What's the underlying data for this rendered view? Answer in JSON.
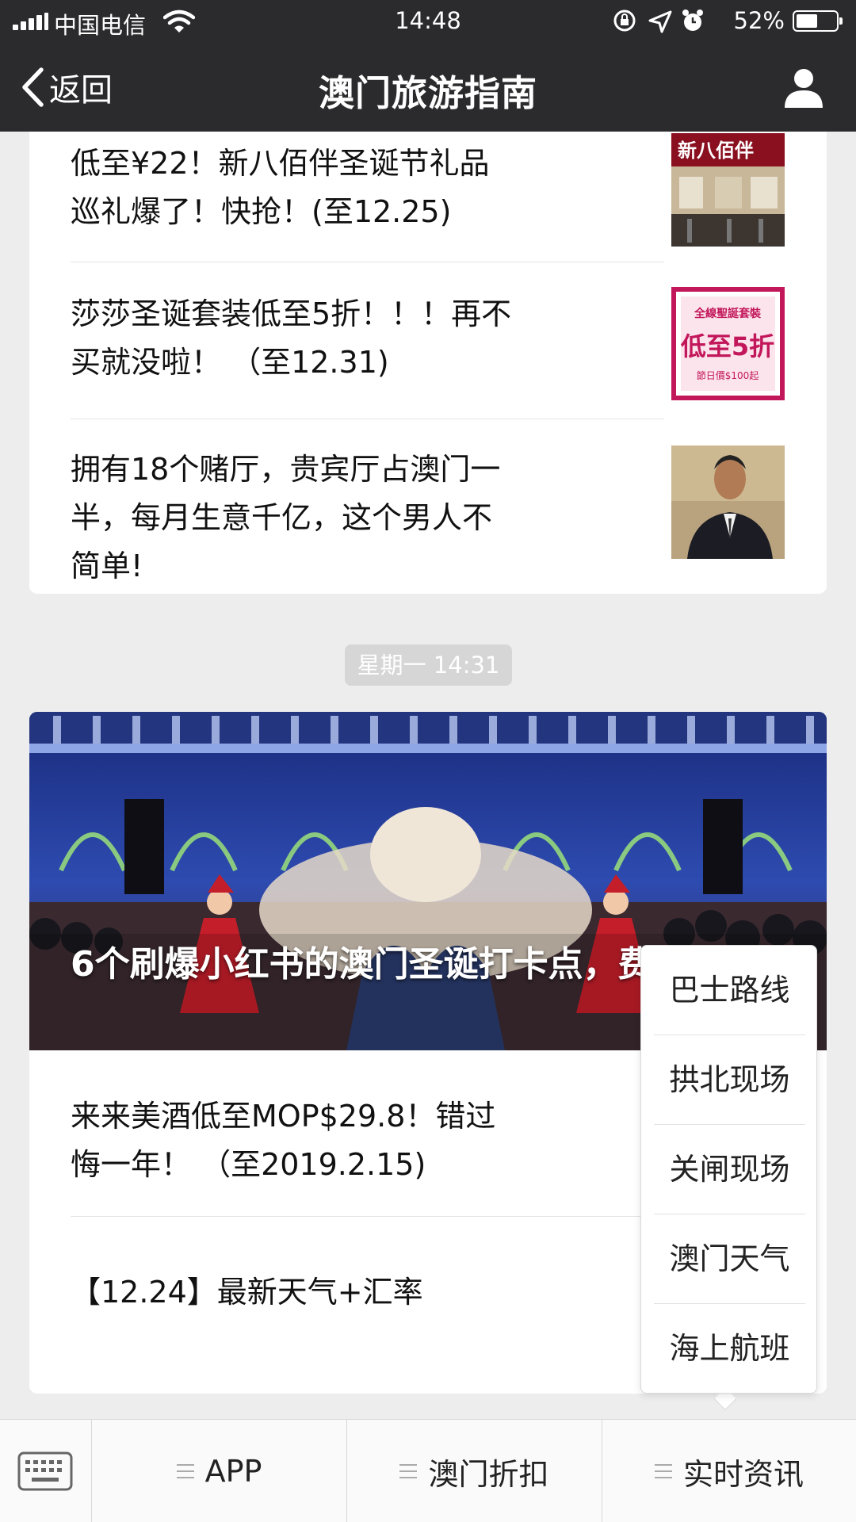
{
  "status_bar": {
    "carrier": "中国电信",
    "time": "14:48",
    "battery": "52%",
    "battery_level": 0.52
  },
  "nav": {
    "back_label": "返回",
    "title": "澳门旅游指南"
  },
  "messages": [
    {
      "items": [
        {
          "title": "低至¥22！新八佰伴圣诞节礼品巡礼爆了！快抢！(至12.25)"
        },
        {
          "title": "莎莎圣诞套装低至5折！！！再不买就没啦！ （至12.31)"
        },
        {
          "title": "拥有18个赌厅，贵宾厅占澳门一半，每月生意千亿，这个男人不简单!"
        }
      ]
    },
    {
      "timestamp": "星期一 14:31",
      "hero_title": "6个刷爆小红书的澳门圣诞打卡点，费！",
      "items": [
        {
          "title": "来来美酒低至MOP$29.8！错过悔一年！ （至2019.2.15)"
        },
        {
          "title": "【12.24】最新天气+汇率"
        }
      ]
    }
  ],
  "bottom_menu": {
    "tabs": [
      {
        "label": "APP"
      },
      {
        "label": "澳门折扣"
      },
      {
        "label": "实时资讯"
      }
    ],
    "submenu": [
      {
        "label": "巴士路线"
      },
      {
        "label": "拱北现场"
      },
      {
        "label": "关闸现场"
      },
      {
        "label": "澳门天气"
      },
      {
        "label": "海上航班"
      }
    ]
  },
  "thumb_labels": {
    "shop_sign": "新八佰伴",
    "promo_top": "全線聖誕套裝",
    "promo_main": "低至5折",
    "promo_bottom": "節日價$100起"
  },
  "colors": {
    "nav_bg": "#2b2b2d",
    "page_bg": "#ededed",
    "promo_accent": "#c2185b"
  }
}
